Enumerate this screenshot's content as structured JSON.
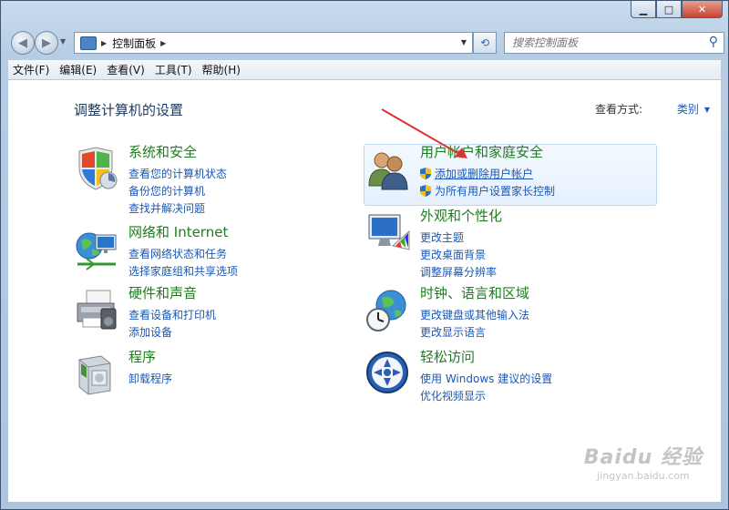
{
  "window": {
    "minimize_icon": "minimize-icon",
    "maximize_icon": "maximize-icon",
    "close_icon": "close-icon"
  },
  "nav": {
    "address_segment": "控制面板",
    "search_placeholder": "搜索控制面板"
  },
  "menu": [
    "文件(F)",
    "编辑(E)",
    "查看(V)",
    "工具(T)",
    "帮助(H)"
  ],
  "page": {
    "title": "调整计算机的设置",
    "view_by_label": "查看方式:",
    "view_by_value": "类别"
  },
  "categories": {
    "system": {
      "heading": "系统和安全",
      "links": [
        "查看您的计算机状态",
        "备份您的计算机",
        "查找并解决问题"
      ]
    },
    "network": {
      "heading": "网络和 Internet",
      "links": [
        "查看网络状态和任务",
        "选择家庭组和共享选项"
      ]
    },
    "hardware": {
      "heading": "硬件和声音",
      "links": [
        "查看设备和打印机",
        "添加设备"
      ]
    },
    "programs": {
      "heading": "程序",
      "links": [
        "卸载程序"
      ]
    },
    "accounts": {
      "heading": "用户帐户和家庭安全",
      "links": [
        "添加或删除用户帐户",
        "为所有用户设置家长控制"
      ]
    },
    "appearance": {
      "heading": "外观和个性化",
      "links": [
        "更改主题",
        "更改桌面背景",
        "调整屏幕分辨率"
      ]
    },
    "clock": {
      "heading": "时钟、语言和区域",
      "links": [
        "更改键盘或其他输入法",
        "更改显示语言"
      ]
    },
    "access": {
      "heading": "轻松访问",
      "links": [
        "使用 Windows 建议的设置",
        "优化视频显示"
      ]
    }
  },
  "watermark": {
    "line1": "Baidu 经验",
    "line2": "jingyan.baidu.com"
  },
  "colors": {
    "heading": "#1e7d1e",
    "link": "#1a58b6",
    "title": "#1e395b"
  }
}
